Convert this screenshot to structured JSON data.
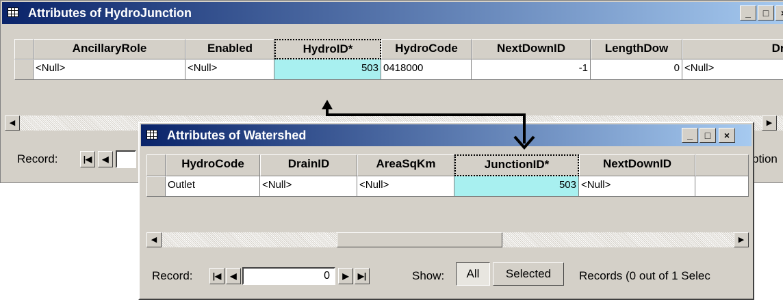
{
  "hydro_window": {
    "title": "Attributes of HydroJunction",
    "columns": [
      "AncillaryRole",
      "Enabled",
      "HydroID*",
      "HydroCode",
      "NextDownID",
      "LengthDow",
      "Dra"
    ],
    "row": [
      "<Null>",
      "<Null>",
      "503",
      "0418000",
      "-1",
      "0",
      "<Null>"
    ],
    "record_label": "Record:",
    "options_fragment": "ption"
  },
  "watershed_window": {
    "title": "Attributes of Watershed",
    "columns": [
      "HydroCode",
      "DrainID",
      "AreaSqKm",
      "JunctionID*",
      "NextDownID"
    ],
    "row": [
      "Outlet",
      "<Null>",
      "<Null>",
      "503",
      "<Null>"
    ],
    "record_label": "Record:",
    "record_value": "0",
    "show_label": "Show:",
    "show_all": "All",
    "show_selected": "Selected",
    "records_status": "Records  (0 out of 1 Selec"
  },
  "window_buttons": {
    "minimize": "_",
    "maximize": "□",
    "close": "×"
  },
  "colors": {
    "highlight": "#a8f0f0",
    "title_active": "#0a246a"
  }
}
